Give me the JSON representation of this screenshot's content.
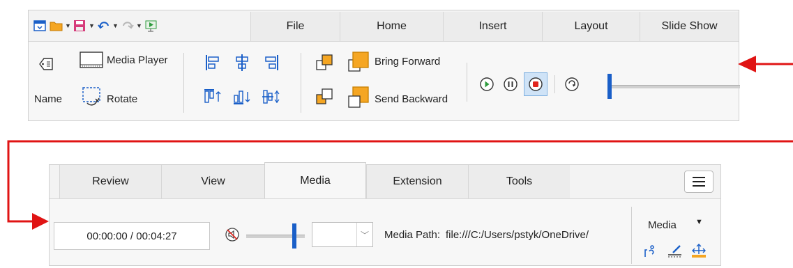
{
  "colors": {
    "arrow": "#e01414",
    "accent": "#1a5fc8",
    "play_green": "#2e9b3e",
    "record_red": "#e0241c",
    "save_pink": "#d63b7a",
    "open_orange": "#f5a623"
  },
  "quick_access": {
    "icons": [
      "window-icon",
      "open-folder-icon",
      "save-icon",
      "undo-icon",
      "redo-icon",
      "start-presentation-icon"
    ]
  },
  "top_tabs": [
    "File",
    "Home",
    "Insert",
    "Layout",
    "Slide Show"
  ],
  "top_ribbon": {
    "name_label": "Name",
    "media_player_label": "Media Player",
    "rotate_label": "Rotate",
    "bring_forward_label": "Bring Forward",
    "send_backward_label": "Send Backward"
  },
  "bottom_tabs": [
    "Review",
    "View",
    "Media",
    "Extension",
    "Tools"
  ],
  "bottom_active_tab": "Media",
  "bottom_ribbon": {
    "time_display": "00:00:00 / 00:04:27",
    "media_path_label": "Media Path:",
    "media_path_value": "file:///C:/Users/pstyk/OneDrive/",
    "media_menu_label": "Media",
    "volume_level": 0.85,
    "position_level": 0.0
  }
}
